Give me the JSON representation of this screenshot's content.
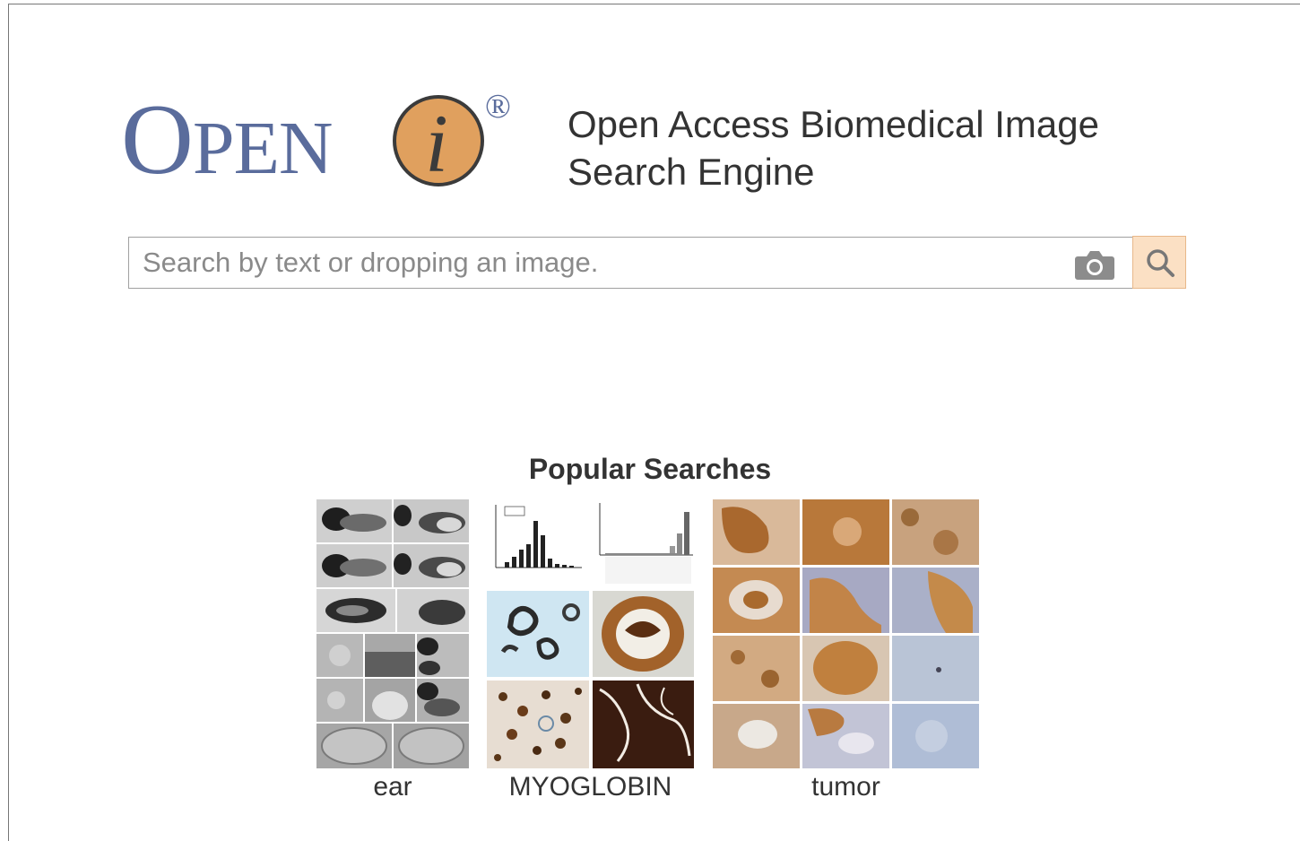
{
  "logo": {
    "wordmark_first": "O",
    "wordmark_rest": "PEN",
    "letter": "i",
    "registered": "®",
    "colors": {
      "wordmark": "#5a6c9c",
      "circle": "#e0a05e",
      "circle_stroke": "#3b3b3b"
    }
  },
  "tagline": {
    "line1": "Open Access Biomedical Image",
    "line2": "Search Engine"
  },
  "search": {
    "placeholder": "Search by text or dropping an image.",
    "value": "",
    "camera_icon": "camera-icon",
    "search_icon": "search-icon",
    "button_color": "#fbe0c4"
  },
  "popular": {
    "title": "Popular Searches",
    "items": [
      {
        "label": "ear"
      },
      {
        "label": "MYOGLOBIN"
      },
      {
        "label": "tumor"
      }
    ]
  }
}
